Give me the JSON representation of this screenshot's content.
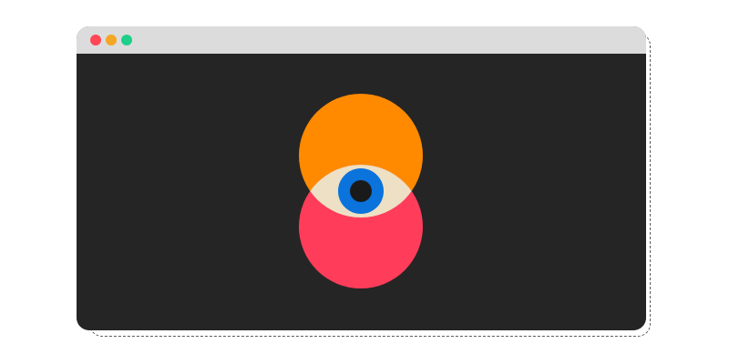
{
  "window": {
    "content_background": "#252525",
    "title_bar_color": "#dcdcdc",
    "controls": [
      {
        "name": "close",
        "color": "#ff4757"
      },
      {
        "name": "minimize",
        "color": "#f5a623"
      },
      {
        "name": "maximize",
        "color": "#1ecf8a"
      }
    ]
  },
  "illustration": {
    "icon": "eye-icon",
    "colors": {
      "top_circle": "#ff8a00",
      "bottom_circle": "#ff3d5a",
      "sclera": "#eee0c4",
      "iris": "#0b73dc",
      "pupil": "#1a1a1a"
    }
  }
}
